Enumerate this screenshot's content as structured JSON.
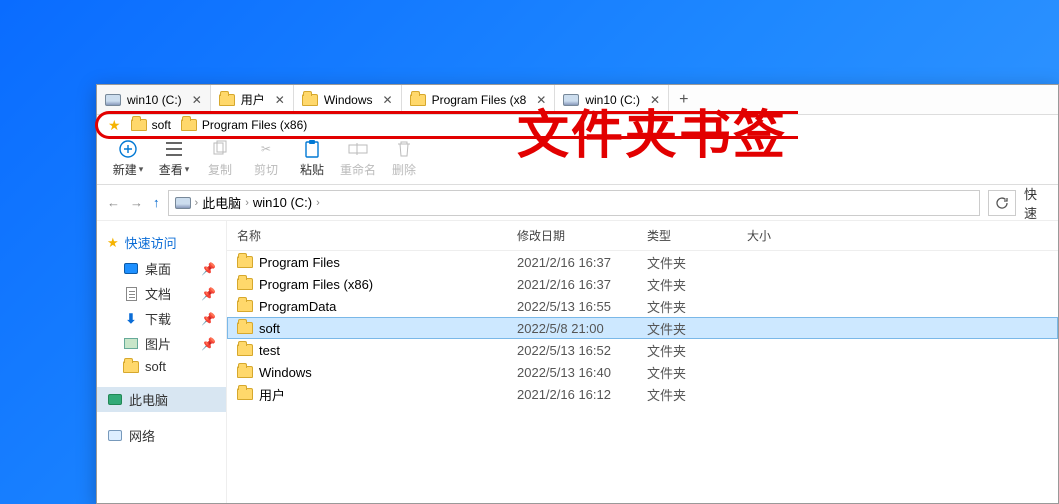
{
  "tabs": [
    {
      "label": "win10 (C:)",
      "icon": "drive"
    },
    {
      "label": "用户",
      "icon": "folder"
    },
    {
      "label": "Windows",
      "icon": "folder"
    },
    {
      "label": "Program Files (x8",
      "icon": "folder"
    },
    {
      "label": "win10 (C:)",
      "icon": "drive"
    }
  ],
  "bookmarks": [
    {
      "label": "soft"
    },
    {
      "label": "Program Files (x86)"
    }
  ],
  "annotation": "文件夹书签",
  "toolbar": {
    "new": "新建",
    "view": "查看",
    "copy": "复制",
    "cut": "剪切",
    "paste": "粘贴",
    "rename": "重命名",
    "delete": "删除"
  },
  "nav": {
    "up_enabled": true
  },
  "breadcrumb": {
    "root_icon": "drive",
    "seg1": "此电脑",
    "seg2": "win10 (C:)"
  },
  "search_label": "快速",
  "sidebar": {
    "quick": "快速访问",
    "items": [
      {
        "label": "桌面",
        "icon": "desktop",
        "pinned": true
      },
      {
        "label": "文档",
        "icon": "doc",
        "pinned": true
      },
      {
        "label": "下载",
        "icon": "dl",
        "pinned": true
      },
      {
        "label": "图片",
        "icon": "pic",
        "pinned": true
      },
      {
        "label": "soft",
        "icon": "folder",
        "pinned": false
      }
    ],
    "thispc": "此电脑",
    "network": "网络"
  },
  "columns": {
    "name": "名称",
    "date": "修改日期",
    "type": "类型",
    "size": "大小"
  },
  "rows": [
    {
      "name": "Program Files",
      "date": "2021/2/16 16:37",
      "type": "文件夹"
    },
    {
      "name": "Program Files (x86)",
      "date": "2021/2/16 16:37",
      "type": "文件夹"
    },
    {
      "name": "ProgramData",
      "date": "2022/5/13 16:55",
      "type": "文件夹"
    },
    {
      "name": "soft",
      "date": "2022/5/8 21:00",
      "type": "文件夹",
      "selected": true
    },
    {
      "name": "test",
      "date": "2022/5/13 16:52",
      "type": "文件夹"
    },
    {
      "name": "Windows",
      "date": "2022/5/13 16:40",
      "type": "文件夹"
    },
    {
      "name": "用户",
      "date": "2021/2/16 16:12",
      "type": "文件夹"
    }
  ]
}
